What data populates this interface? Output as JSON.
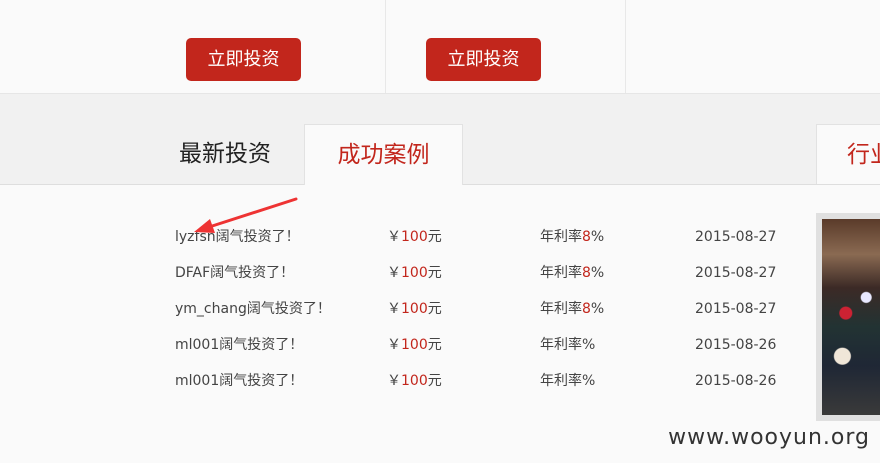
{
  "invest_buttons": [
    "立即投资",
    "立即投资"
  ],
  "tabs": {
    "latest": "最新投资",
    "success": "成功案例",
    "industry": "行业"
  },
  "rows": [
    {
      "name": "lyzfsn阔气投资了！",
      "currency": "￥",
      "amount": "100",
      "unit": "元",
      "rate_label": "年利率",
      "rate_value": "8",
      "percent": "%",
      "date": "2015-08-27"
    },
    {
      "name": "DFAF阔气投资了！",
      "currency": "￥",
      "amount": "100",
      "unit": "元",
      "rate_label": "年利率",
      "rate_value": "8",
      "percent": "%",
      "date": "2015-08-27"
    },
    {
      "name": "ym_chang阔气投资了！",
      "currency": "￥",
      "amount": "100",
      "unit": "元",
      "rate_label": "年利率",
      "rate_value": "8",
      "percent": "%",
      "date": "2015-08-27"
    },
    {
      "name": "ml001阔气投资了！",
      "currency": "￥",
      "amount": "100",
      "unit": "元",
      "rate_label": "年利率",
      "rate_value": "",
      "percent": "%",
      "date": "2015-08-26"
    },
    {
      "name": "ml001阔气投资了！",
      "currency": "￥",
      "amount": "100",
      "unit": "元",
      "rate_label": "年利率",
      "rate_value": "",
      "percent": "%",
      "date": "2015-08-26"
    }
  ],
  "watermark": "www.wooyun.org",
  "colors": {
    "accent": "#c2261c",
    "text": "#444444"
  },
  "icons": {
    "annotation": "red-arrow-icon"
  }
}
